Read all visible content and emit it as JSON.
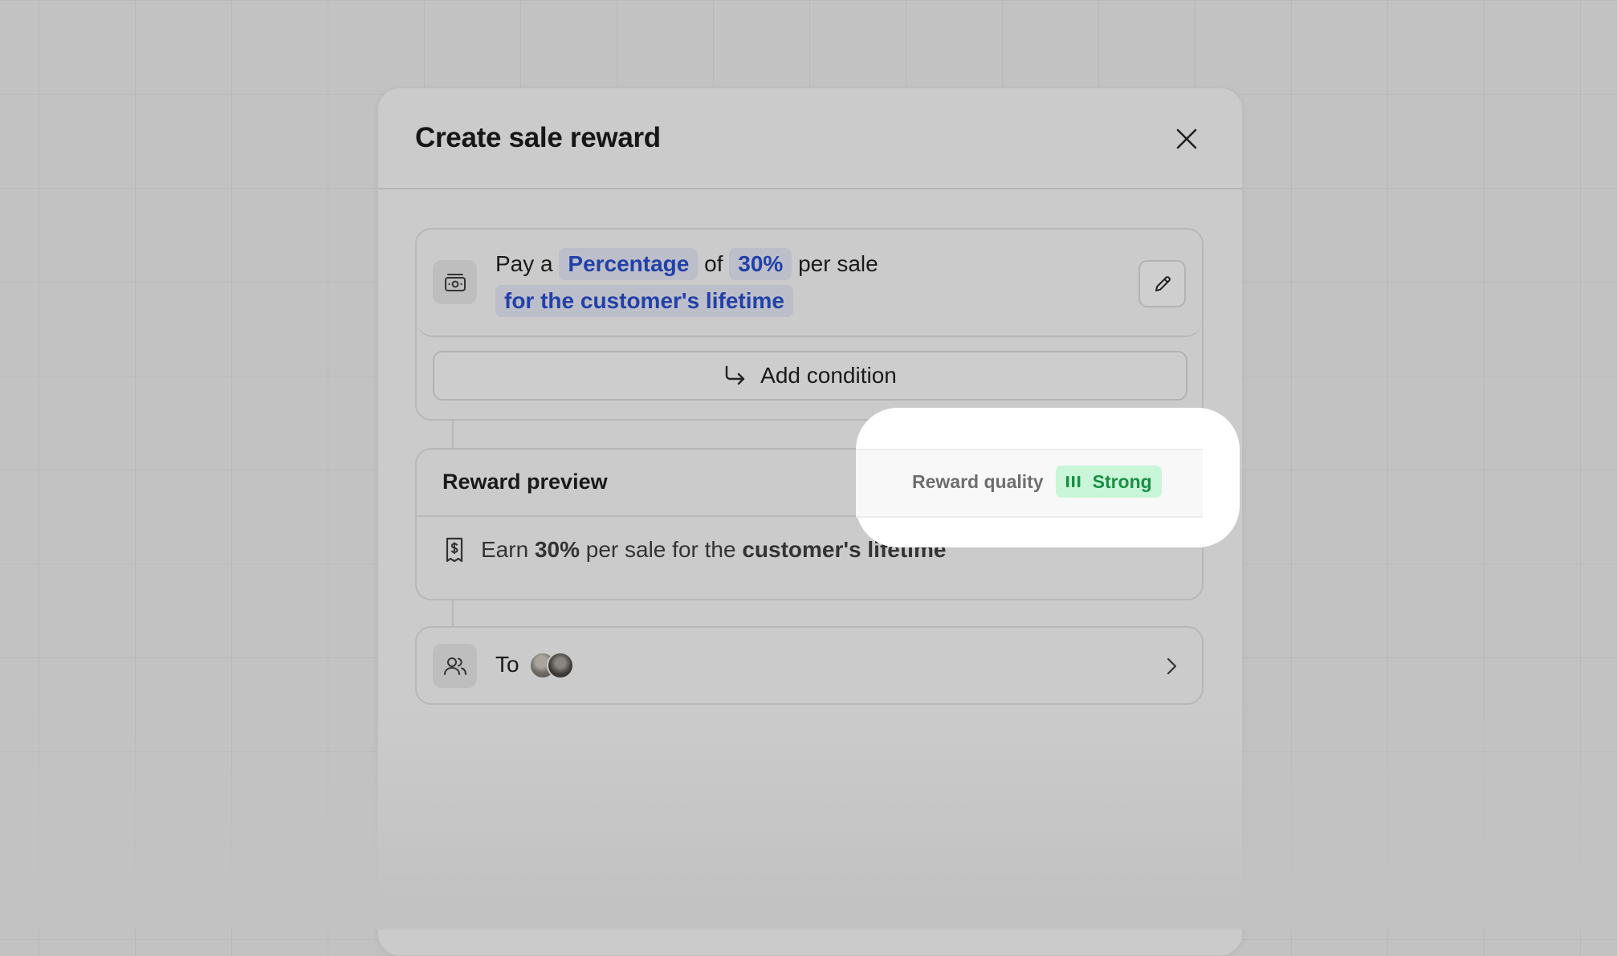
{
  "modal": {
    "title": "Create sale reward"
  },
  "reward": {
    "prefix": "Pay a",
    "type": "Percentage",
    "of": "of",
    "amount": "30%",
    "suffix": "per sale",
    "duration": "for the customer's lifetime"
  },
  "add_condition_label": "Add condition",
  "preview": {
    "title": "Reward preview",
    "quality_label": "Reward quality",
    "quality_value": "Strong",
    "quality_color": "#1a8f44",
    "earn": "Earn",
    "amount": "30%",
    "middle": "per sale for the",
    "duration": "customer's lifetime"
  },
  "recipients": {
    "label": "To"
  },
  "icons": {
    "close": "close-icon",
    "money": "money-icon",
    "edit": "pencil-icon",
    "condition": "arrow-turn-right-icon",
    "receipt": "receipt-dollar-icon",
    "users": "users-icon",
    "chevron": "chevron-right-icon"
  }
}
